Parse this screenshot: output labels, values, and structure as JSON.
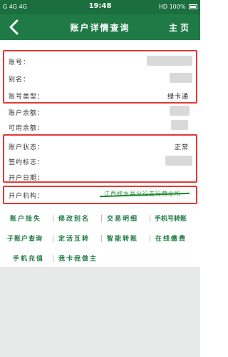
{
  "status_bar": {
    "left": "G 4G 4G",
    "time": "19:48",
    "right": "HD 100%"
  },
  "header": {
    "back_icon": "chevron-left-icon",
    "title": "账户详情查询",
    "home_label": "主页"
  },
  "details": {
    "account_no_label": "账号：",
    "alias_label": "别名：",
    "account_type_label": "账号类型：",
    "account_type_value": "绿卡通",
    "balance_label": "账户余额：",
    "available_label": "可用余额：",
    "status_label": "账户状态：",
    "status_value": "正常",
    "sign_label": "签约标志：",
    "open_date_label": "开户日期：",
    "branch_label": "开户机构：",
    "branch_value": "江西修水县分行支行营业所"
  },
  "actions": [
    "账户挂失",
    "修改别名",
    "交易明细",
    "手机号转账",
    "子账户查询",
    "定活互转",
    "智能转账",
    "在线缴费",
    "手机充值",
    "我卡我做主"
  ],
  "colors": {
    "primary": "#1f7a45",
    "highlight_box": "#e53935",
    "link": "#1f7a45"
  }
}
